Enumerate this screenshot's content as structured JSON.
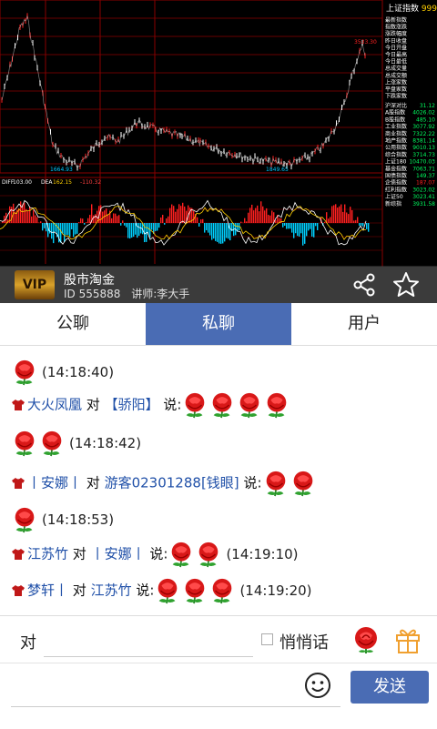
{
  "chart": {
    "index_title": "上证指数",
    "index_value": "999",
    "labels": {
      "low1": "1664.93",
      "low2": "1849.65",
      "high": "3533.30"
    },
    "indicator_header": [
      "DIFF",
      "103.00",
      "DEA",
      "162.15",
      "-110.32"
    ],
    "side_menu": [
      "最新指数",
      "指数涨跌",
      "涨跌幅度",
      "昨日收盘",
      "今日开盘",
      "今日最高",
      "今日最低",
      "总成交量",
      "总成交额",
      "上涨家数",
      "平盘家数",
      "下跌家数"
    ],
    "side_stats": [
      {
        "label": "沪深对比",
        "value": "31.12"
      },
      {
        "label": "A股指数",
        "value": "4026.02"
      },
      {
        "label": "B股指数",
        "value": "485.10"
      },
      {
        "label": "工业指数",
        "value": "3077.92"
      },
      {
        "label": "商业指数",
        "value": "7322.22"
      },
      {
        "label": "地产指数",
        "value": "8381.14"
      },
      {
        "label": "公用指数",
        "value": "9010.13"
      },
      {
        "label": "综合指数",
        "value": "3714.73"
      },
      {
        "label": "上证180",
        "value": "10470.03"
      },
      {
        "label": "基金指数",
        "value": "7063.71"
      },
      {
        "label": "国债指数",
        "value": "149.37"
      },
      {
        "label": "企债指数",
        "value": "187.07"
      },
      {
        "label": "红利指数",
        "value": "3023.02"
      },
      {
        "label": "上证50",
        "value": "3023.41"
      },
      {
        "label": "新综指",
        "value": "3931.58"
      }
    ]
  },
  "room": {
    "name": "股市淘金",
    "id_text": "ID 555888",
    "lecturer": "讲师:李大手",
    "logo_text": "VIP"
  },
  "tabs": [
    "公聊",
    "私聊",
    "用户"
  ],
  "active_tab": 1,
  "messages": [
    {
      "time": "(14:18:40)"
    },
    {
      "from": "大火凤凰",
      "to_word": "对",
      "target": "【骄阳】",
      "say": "说:",
      "time": "(14:18:42)"
    },
    {
      "from": "丨安娜丨",
      "to_word": "对",
      "target": "游客02301288[钱眼]",
      "say": "说:",
      "time": "(14:18:53)"
    },
    {
      "from": "江苏竹",
      "to_word": "对",
      "target": "丨安娜丨",
      "say": "说:",
      "time": "(14:19:10)"
    },
    {
      "from": "梦轩丨",
      "to_word": "对",
      "target": "江苏竹",
      "say": "说:",
      "time": "(14:19:20)"
    }
  ],
  "input": {
    "to_label": "对",
    "whisper_label": "悄悄话",
    "send_label": "发送"
  },
  "icons": {
    "share": "share-icon",
    "favorite": "star-icon",
    "rose": "rose-icon",
    "gift": "gift-icon",
    "emoji": "smiley-icon",
    "user_badge": "shirt-icon"
  },
  "colors": {
    "accent": "#4a6cb4",
    "user_name": "#2050a8",
    "chart_bg": "#000000",
    "grid": "#8a0000",
    "up": "#ff2020",
    "down": "#00d0ff"
  }
}
